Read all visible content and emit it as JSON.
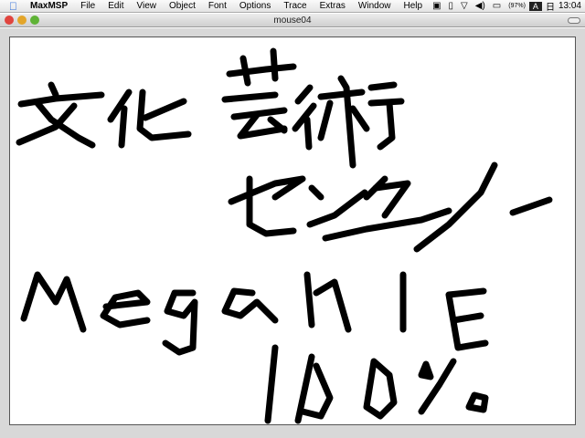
{
  "menubar": {
    "app": "MaxMSP",
    "items": [
      "File",
      "Edit",
      "View",
      "Object",
      "Font",
      "Options",
      "Trace",
      "Extras",
      "Window",
      "Help"
    ],
    "battery": "(97%)",
    "clock": "13:04"
  },
  "window": {
    "title": "mouse04"
  }
}
